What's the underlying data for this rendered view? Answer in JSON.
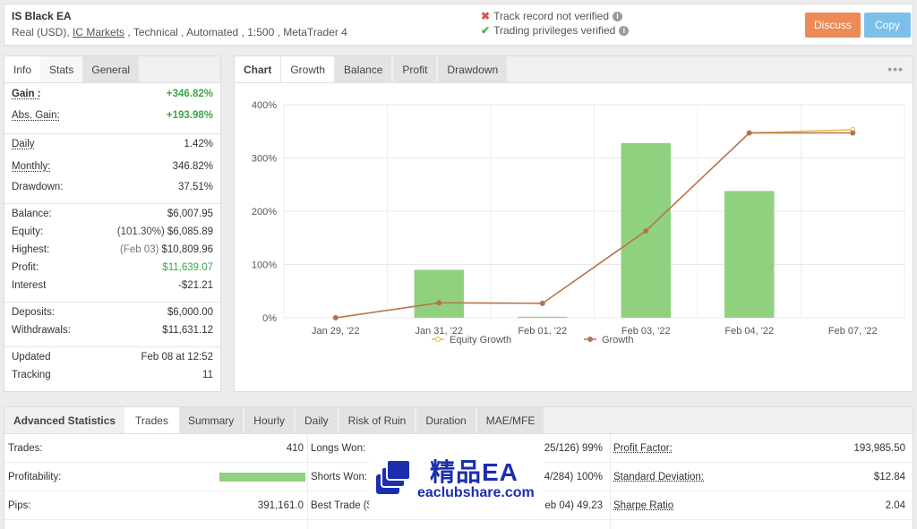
{
  "header": {
    "title": "IS Black EA",
    "subtitle_pre": "Real (USD), ",
    "subtitle_link": "IC Markets",
    "subtitle_post": " , Technical , Automated , 1:500 , MetaTrader 4",
    "verif1": "Track record not verified",
    "verif2": "Trading privileges verified",
    "discuss": "Discuss",
    "copy": "Copy"
  },
  "left_tabs": [
    "Info",
    "Stats",
    "General"
  ],
  "stats": {
    "gain": {
      "k": "Gain :",
      "v": "+346.82%"
    },
    "abs_gain": {
      "k": "Abs. Gain:",
      "v": "+193.98%"
    },
    "daily": {
      "k": "Daily",
      "v": "1.42%"
    },
    "monthly": {
      "k": "Monthly:",
      "v": "346.82%"
    },
    "drawdown": {
      "k": "Drawdown:",
      "v": "37.51%"
    },
    "balance": {
      "k": "Balance:",
      "v": "$6,007.95"
    },
    "equity": {
      "k": "Equity:",
      "pre": "(101.30%)",
      "v": "$6,085.89"
    },
    "highest": {
      "k": "Highest:",
      "pre": "(Feb 03)",
      "v": "$10,809.96"
    },
    "profit": {
      "k": "Profit:",
      "v": "$11,639.07"
    },
    "interest": {
      "k": "Interest",
      "v": "-$21.21"
    },
    "deposits": {
      "k": "Deposits:",
      "v": "$6,000.00"
    },
    "withdrawals": {
      "k": "Withdrawals:",
      "v": "$11,631.12"
    },
    "updated": {
      "k": "Updated",
      "v": "Feb 08 at 12:52"
    },
    "tracking": {
      "k": "Tracking",
      "v": "11"
    }
  },
  "chart_tabs": [
    "Chart",
    "Growth",
    "Balance",
    "Profit",
    "Drawdown"
  ],
  "chart_more": "•••",
  "chart_data": {
    "type": "bar",
    "categories": [
      "Jan 29, '22",
      "Jan 31, '22",
      "Feb 01, '22",
      "Feb 03, '22",
      "Feb 04, '22",
      "Feb 07, '22"
    ],
    "ylim": [
      0,
      400
    ],
    "yticks": [
      "0%",
      "100%",
      "200%",
      "300%",
      "400%"
    ],
    "bar_color": "#8fd17f",
    "bars": [
      0,
      90,
      2,
      328,
      238,
      0
    ],
    "series": [
      {
        "name": "Equity Growth",
        "color": "#e8b84a",
        "values": [
          0,
          28,
          27,
          163,
          347,
          353
        ]
      },
      {
        "name": "Growth",
        "color": "#b5734f",
        "values": [
          0,
          28,
          27,
          163,
          347,
          347
        ]
      }
    ],
    "legend": "bottom",
    "grid": true
  },
  "bottom_tabs": [
    "Advanced Statistics",
    "Trades",
    "Summary",
    "Hourly",
    "Daily",
    "Risk of Ruin",
    "Duration",
    "MAE/MFE"
  ],
  "bottom": {
    "rows": [
      {
        "a_k": "Trades:",
        "a_v": "410",
        "b_k": "Longs Won:",
        "b_v": "25/126) 99%",
        "c_k": "Profit Factor:",
        "c_v": "193,985.50"
      },
      {
        "a_k": "Profitability:",
        "a_v": "",
        "b_k": "Shorts Won:",
        "b_v": "4/284) 100%",
        "c_k": "Standard Deviation:",
        "c_v": "$12.84"
      },
      {
        "a_k": "Pips:",
        "a_v": "391,161.0",
        "b_k": "Best Trade ($",
        "b_v": "eb 04) 49.23",
        "c_k": "Sharpe Ratio",
        "c_v": "2.04"
      }
    ],
    "profitability": 1.0
  },
  "watermark": {
    "cn": "精品EA",
    "url": "eaclubshare.com"
  }
}
